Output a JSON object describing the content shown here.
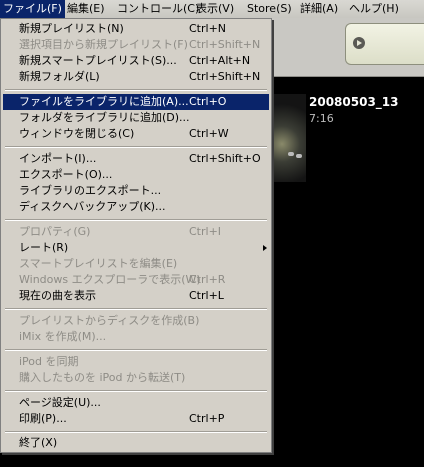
{
  "menubar": {
    "items": [
      {
        "label": "ファイル(F)"
      },
      {
        "label": "編集(E)"
      },
      {
        "label": "コントロール(C)"
      },
      {
        "label": "表示(V)"
      },
      {
        "label": "Store(S)"
      },
      {
        "label": "詳細(A)"
      },
      {
        "label": "ヘルプ(H)"
      }
    ]
  },
  "file_menu": {
    "items": [
      {
        "label": "新規プレイリスト(N)",
        "shortcut": "Ctrl+N",
        "enabled": true
      },
      {
        "label": "選択項目から新規プレイリスト(F)",
        "shortcut": "Ctrl+Shift+N",
        "enabled": false
      },
      {
        "label": "新規スマートプレイリスト(S)...",
        "shortcut": "Ctrl+Alt+N",
        "enabled": true
      },
      {
        "label": "新規フォルダ(L)",
        "shortcut": "Ctrl+Shift+N",
        "enabled": true
      },
      {
        "label": "ファイルをライブラリに追加(A)...",
        "shortcut": "Ctrl+O",
        "enabled": true,
        "highlighted": true
      },
      {
        "label": "フォルダをライブラリに追加(D)...",
        "shortcut": "",
        "enabled": true
      },
      {
        "label": "ウィンドウを閉じる(C)",
        "shortcut": "Ctrl+W",
        "enabled": true
      },
      {
        "label": "インポート(I)...",
        "shortcut": "Ctrl+Shift+O",
        "enabled": true
      },
      {
        "label": "エクスポート(O)...",
        "shortcut": "",
        "enabled": true
      },
      {
        "label": "ライブラリのエクスポート...",
        "shortcut": "",
        "enabled": true
      },
      {
        "label": "ディスクへバックアップ(K)...",
        "shortcut": "",
        "enabled": true
      },
      {
        "label": "プロパティ(G)",
        "shortcut": "Ctrl+I",
        "enabled": false
      },
      {
        "label": "レート(R)",
        "shortcut": "",
        "enabled": true,
        "submenu": true
      },
      {
        "label": "スマートプレイリストを編集(E)",
        "shortcut": "",
        "enabled": false
      },
      {
        "label": "Windows エクスプローラで表示(W)",
        "shortcut": "Ctrl+R",
        "enabled": false
      },
      {
        "label": "現在の曲を表示",
        "shortcut": "Ctrl+L",
        "enabled": true
      },
      {
        "label": "プレイリストからディスクを作成(B)",
        "shortcut": "",
        "enabled": false
      },
      {
        "label": "iMix を作成(M)...",
        "shortcut": "",
        "enabled": false
      },
      {
        "label": "iPod を同期",
        "shortcut": "",
        "enabled": false
      },
      {
        "label": "購入したものを iPod から転送(T)",
        "shortcut": "",
        "enabled": false
      },
      {
        "label": "ページ設定(U)...",
        "shortcut": "",
        "enabled": true
      },
      {
        "label": "印刷(P)...",
        "shortcut": "Ctrl+P",
        "enabled": true
      },
      {
        "label": "終了(X)",
        "shortcut": "",
        "enabled": true
      }
    ]
  },
  "video": {
    "title": "20080503_13",
    "duration": "7:16"
  }
}
